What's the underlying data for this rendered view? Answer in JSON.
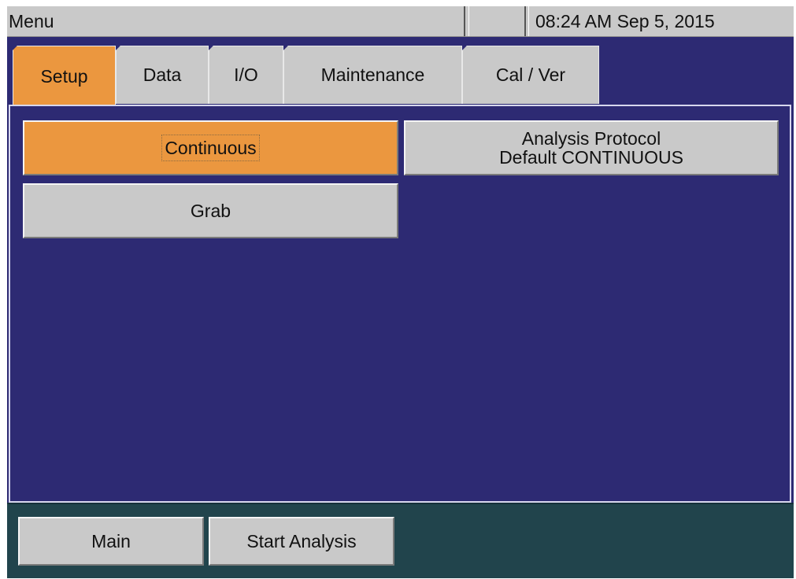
{
  "statusbar": {
    "title": "Menu",
    "clock": "08:24 AM Sep 5, 2015"
  },
  "tabs": [
    {
      "label": "Setup",
      "active": true
    },
    {
      "label": "Data",
      "active": false
    },
    {
      "label": "I/O",
      "active": false
    },
    {
      "label": "Maintenance",
      "active": false
    },
    {
      "label": "Cal / Ver",
      "active": false
    }
  ],
  "main": {
    "continuous_label": "Continuous",
    "grab_label": "Grab",
    "protocol": {
      "line1": "Analysis Protocol",
      "line2": "Default CONTINUOUS"
    }
  },
  "footer": {
    "main_label": "Main",
    "start_label": "Start Analysis"
  },
  "colors": {
    "background": "#2d2a73",
    "selected": "#eb973f",
    "button": "#c9c9c9",
    "footer": "#21444c"
  }
}
